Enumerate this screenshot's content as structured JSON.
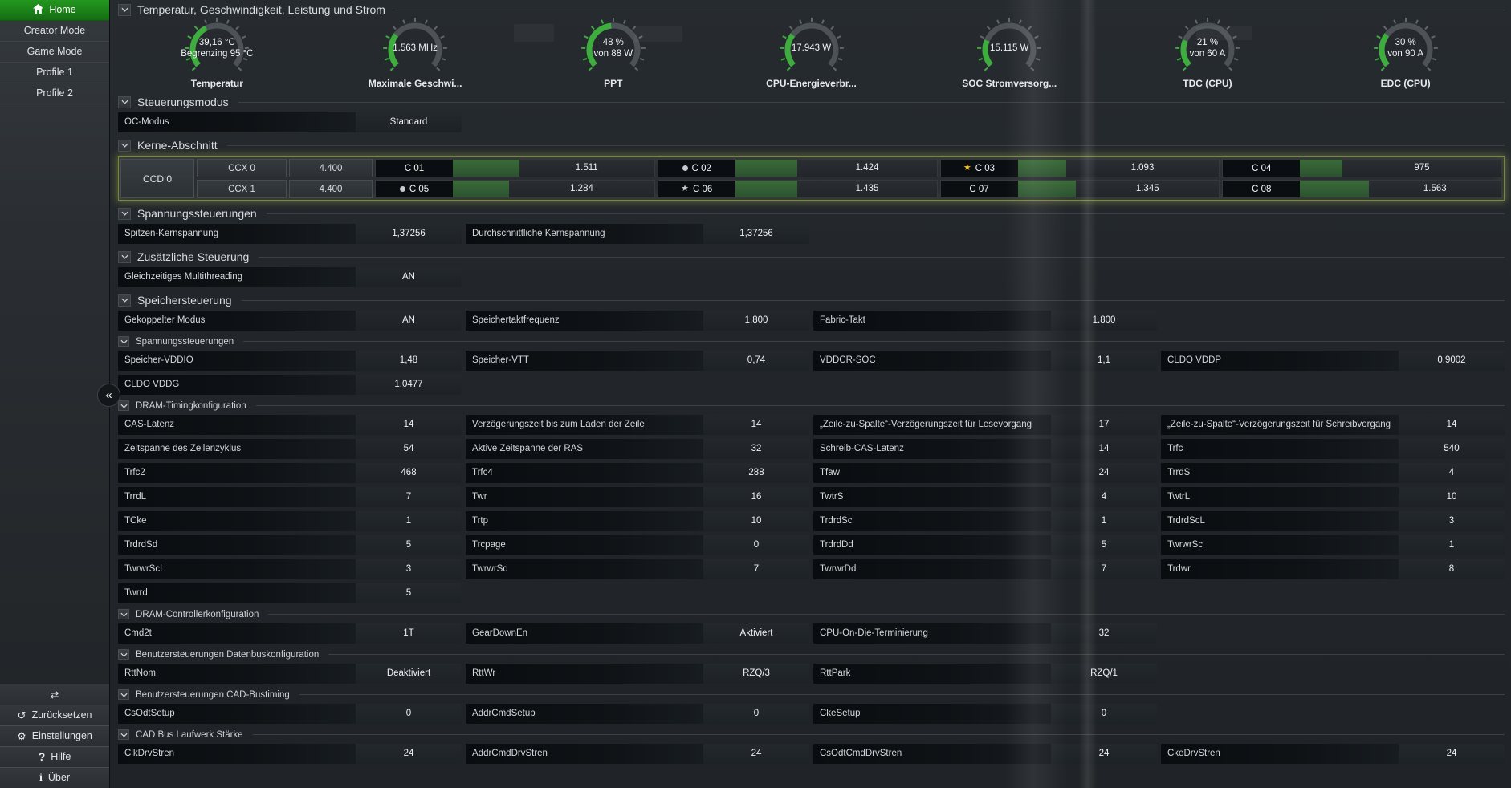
{
  "sidebar": {
    "items": [
      {
        "label": "Home",
        "active": true
      },
      {
        "label": "Creator Mode",
        "active": false
      },
      {
        "label": "Game Mode",
        "active": false
      },
      {
        "label": "Profile 1",
        "active": false
      },
      {
        "label": "Profile 2",
        "active": false
      }
    ],
    "bottom_items": [
      {
        "icon": "view-toggle",
        "label": ""
      },
      {
        "icon": "reset",
        "label": "Zurücksetzen"
      },
      {
        "icon": "gear",
        "label": "Einstellungen"
      },
      {
        "icon": "help",
        "label": "Hilfe"
      },
      {
        "icon": "info",
        "label": "Über"
      }
    ],
    "collapse_glyph": "«"
  },
  "gauge_section": {
    "title": "Temperatur, Geschwindigkeit, Leistung und Strom"
  },
  "gauges": [
    {
      "line1": "39,16 °C",
      "line2": "Begrenzing 95 °C",
      "label": "Temperatur",
      "fraction": 0.4
    },
    {
      "line1": "1.563  MHz",
      "line2": "",
      "label": "Maximale Geschwi...",
      "fraction": 0.3
    },
    {
      "line1": "48 %",
      "line2": "von 88 W",
      "label": "PPT",
      "fraction": 0.48
    },
    {
      "line1": "17.943 W",
      "line2": "",
      "label": "CPU-Energieverbr...",
      "fraction": 0.3
    },
    {
      "line1": "15.115 W",
      "line2": "",
      "label": "SOC Stromversorg...",
      "fraction": 0.24
    },
    {
      "line1": "21 %",
      "line2": "von 60 A",
      "label": "TDC (CPU)",
      "fraction": 0.24
    },
    {
      "line1": "30 %",
      "line2": "von 90 A",
      "label": "EDC (CPU)",
      "fraction": 0.3
    }
  ],
  "cores": {
    "ccd_label": "CCD 0",
    "rows": [
      {
        "ccx": "CCX 0",
        "freq": "4.400",
        "cores": [
          {
            "name": "C 01",
            "icon": "none",
            "value": "1.511",
            "bar": 0.33
          },
          {
            "name": "C 02",
            "icon": "dot",
            "value": "1.424",
            "bar": 0.31
          },
          {
            "name": "C 03",
            "icon": "star-gold",
            "value": "1.093",
            "bar": 0.24
          },
          {
            "name": "C 04",
            "icon": "none",
            "value": "975",
            "bar": 0.21
          }
        ]
      },
      {
        "ccx": "CCX 1",
        "freq": "4.400",
        "cores": [
          {
            "name": "C 05",
            "icon": "dot",
            "value": "1.284",
            "bar": 0.28
          },
          {
            "name": "C 06",
            "icon": "star-gray",
            "value": "1.435",
            "bar": 0.31
          },
          {
            "name": "C 07",
            "icon": "none",
            "value": "1.345",
            "bar": 0.29
          },
          {
            "name": "C 08",
            "icon": "none",
            "value": "1.563",
            "bar": 0.34
          }
        ]
      }
    ]
  },
  "panels": [
    {
      "title": "Steuerungsmodus",
      "level": 1,
      "type": "rows",
      "rows": [
        [
          {
            "label": "OC-Modus",
            "value": "Standard"
          }
        ]
      ]
    },
    {
      "title": "Kerne-Abschnitt",
      "level": 1,
      "type": "cores"
    },
    {
      "title": "Spannungssteuerungen",
      "level": 1,
      "type": "rows",
      "rows": [
        [
          {
            "label": "Spitzen-Kernspannung",
            "value": "1,37256"
          },
          {
            "label": "Durchschnittliche Kernspannung",
            "value": "1,37256"
          }
        ]
      ]
    },
    {
      "title": "Zusätzliche Steuerung",
      "level": 1,
      "type": "rows",
      "rows": [
        [
          {
            "label": "Gleichzeitiges Multithreading",
            "value": "AN"
          }
        ]
      ]
    },
    {
      "title": "Speichersteuerung",
      "level": 1,
      "type": "rows",
      "rows": [
        [
          {
            "label": "Gekoppelter Modus",
            "value": "AN"
          },
          {
            "label": "Speichertaktfrequenz",
            "value": "1.800"
          },
          {
            "label": "Fabric-Takt",
            "value": "1.800"
          }
        ]
      ]
    },
    {
      "title": "Spannungssteuerungen",
      "level": 2,
      "type": "rows",
      "rows": [
        [
          {
            "label": "Speicher-VDDIO",
            "value": "1,48"
          },
          {
            "label": "Speicher-VTT",
            "value": "0,74"
          },
          {
            "label": "VDDCR-SOC",
            "value": "1,1"
          },
          {
            "label": "CLDO VDDP",
            "value": "0,9002"
          }
        ],
        [
          {
            "label": "CLDO VDDG",
            "value": "1,0477"
          }
        ]
      ]
    },
    {
      "title": "DRAM-Timingkonfiguration",
      "level": 2,
      "type": "rows",
      "rows": [
        [
          {
            "label": "CAS-Latenz",
            "value": "14"
          },
          {
            "label": "Verzögerungszeit bis zum Laden der Zeile",
            "value": "14"
          },
          {
            "label": "„Zeile-zu-Spalte“-Verzögerungszeit für Lesevorgang",
            "value": "17"
          },
          {
            "label": "„Zeile-zu-Spalte“-Verzögerungszeit für Schreibvorgang",
            "value": "14"
          }
        ],
        [
          {
            "label": "Zeitspanne des Zeilenzyklus",
            "value": "54"
          },
          {
            "label": "Aktive Zeitspanne der RAS",
            "value": "32"
          },
          {
            "label": "Schreib-CAS-Latenz",
            "value": "14"
          },
          {
            "label": "Trfc",
            "value": "540"
          }
        ],
        [
          {
            "label": "Trfc2",
            "value": "468"
          },
          {
            "label": "Trfc4",
            "value": "288"
          },
          {
            "label": "Tfaw",
            "value": "24"
          },
          {
            "label": "TrrdS",
            "value": "4"
          }
        ],
        [
          {
            "label": "TrrdL",
            "value": "7"
          },
          {
            "label": "Twr",
            "value": "16"
          },
          {
            "label": "TwtrS",
            "value": "4"
          },
          {
            "label": "TwtrL",
            "value": "10"
          }
        ],
        [
          {
            "label": "TCke",
            "value": "1"
          },
          {
            "label": "Trtp",
            "value": "10"
          },
          {
            "label": "TrdrdSc",
            "value": "1"
          },
          {
            "label": "TrdrdScL",
            "value": "3"
          }
        ],
        [
          {
            "label": "TrdrdSd",
            "value": "5"
          },
          {
            "label": "Trcpage",
            "value": "0"
          },
          {
            "label": "TrdrdDd",
            "value": "5"
          },
          {
            "label": "TwrwrSc",
            "value": "1"
          }
        ],
        [
          {
            "label": "TwrwrScL",
            "value": "3"
          },
          {
            "label": "TwrwrSd",
            "value": "7"
          },
          {
            "label": "TwrwrDd",
            "value": "7"
          },
          {
            "label": "Trdwr",
            "value": "8"
          }
        ],
        [
          {
            "label": "Twrrd",
            "value": "5"
          }
        ]
      ]
    },
    {
      "title": "DRAM-Controllerkonfiguration",
      "level": 2,
      "type": "rows",
      "rows": [
        [
          {
            "label": "Cmd2t",
            "value": "1T"
          },
          {
            "label": "GearDownEn",
            "value": "Aktiviert"
          },
          {
            "label": "CPU-On-Die-Terminierung",
            "value": "32"
          }
        ]
      ]
    },
    {
      "title": "Benutzersteuerungen Datenbuskonfiguration",
      "level": 2,
      "type": "rows",
      "rows": [
        [
          {
            "label": "RttNom",
            "value": "Deaktiviert"
          },
          {
            "label": "RttWr",
            "value": "RZQ/3"
          },
          {
            "label": "RttPark",
            "value": "RZQ/1"
          }
        ]
      ]
    },
    {
      "title": "Benutzersteuerungen CAD-Bustiming",
      "level": 2,
      "type": "rows",
      "rows": [
        [
          {
            "label": "CsOdtSetup",
            "value": "0"
          },
          {
            "label": "AddrCmdSetup",
            "value": "0"
          },
          {
            "label": "CkeSetup",
            "value": "0"
          }
        ]
      ]
    },
    {
      "title": "CAD Bus Laufwerk Stärke",
      "level": 2,
      "type": "rows",
      "rows": [
        [
          {
            "label": "ClkDrvStren",
            "value": "24"
          },
          {
            "label": "AddrCmdDrvStren",
            "value": "24"
          },
          {
            "label": "CsOdtCmdDrvStren",
            "value": "24"
          },
          {
            "label": "CkeDrvStren",
            "value": "24"
          }
        ]
      ]
    }
  ],
  "colors": {
    "accent_green": "#1e8c1c",
    "gauge_green": "#3dae3d",
    "gauge_track": "#4d5256",
    "core_bar_green": "#2f5c2f",
    "highlight_border": "#a8b84e",
    "star_gold": "#f5c518",
    "star_gray": "#cdd1d5"
  }
}
